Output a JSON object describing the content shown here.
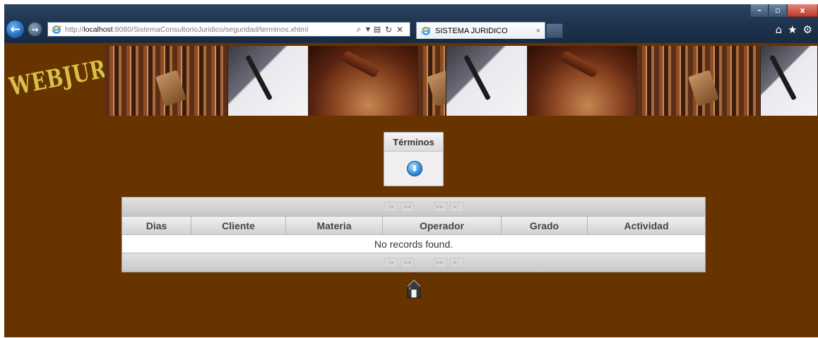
{
  "browser": {
    "url_prefix": "http://",
    "url_host": "localhost",
    "url_rest": ":8080/SistemaConsultorioJuridico/seguridad/terminos.xhtml",
    "address_icons": [
      "search-icon",
      "dropdown-icon",
      "compat-view-icon",
      "refresh-icon",
      "stop-icon"
    ],
    "tab_title": "SISTEMA JURIDICO",
    "tab_close": "×",
    "window_buttons": [
      "–",
      "▫",
      "x"
    ]
  },
  "header": {
    "logo": "WEBJURIS"
  },
  "panel": {
    "title": "Términos",
    "action_icon": "download-icon"
  },
  "table": {
    "columns": [
      "Dias",
      "Cliente",
      "Materia",
      "Operador",
      "Grado",
      "Actividad"
    ],
    "empty_message": "No records found.",
    "paginator_buttons": [
      "first-page-icon",
      "prev-page-icon",
      "next-page-icon",
      "last-page-icon"
    ]
  },
  "footer": {
    "home_icon": "home-icon"
  },
  "colors": {
    "page_background": "#673400",
    "logo": "#d8c14a"
  }
}
